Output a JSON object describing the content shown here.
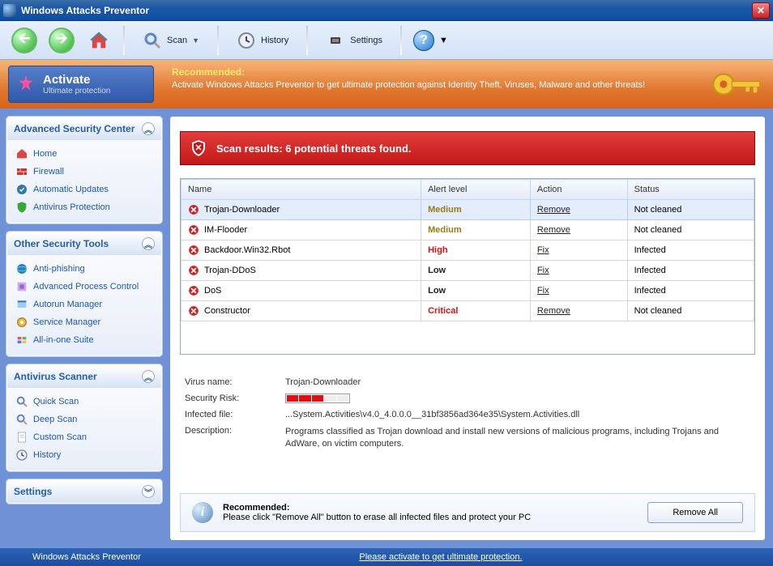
{
  "title": "Windows Attacks Preventor",
  "toolbar": {
    "scan": "Scan",
    "history": "History",
    "settings": "Settings"
  },
  "banner": {
    "activate": "Activate",
    "activate_sub": "Ultimate protection",
    "head": "Recommended:",
    "body": "Activate Windows Attacks Preventor to get ultimate protection against Identity Theft, Viruses, Malware and other threats!"
  },
  "panels": {
    "security": {
      "title": "Advanced Security Center",
      "items": [
        "Home",
        "Firewall",
        "Automatic Updates",
        "Antivirus Protection"
      ]
    },
    "tools": {
      "title": "Other Security Tools",
      "items": [
        "Anti-phishing",
        "Advanced Process Control",
        "Autorun Manager",
        "Service Manager",
        "All-in-one Suite"
      ]
    },
    "scanner": {
      "title": "Antivirus Scanner",
      "items": [
        "Quick Scan",
        "Deep Scan",
        "Custom Scan",
        "History"
      ]
    },
    "settings": {
      "title": "Settings"
    }
  },
  "results": {
    "header": "Scan results: 6 potential threats found.",
    "columns": [
      "Name",
      "Alert level",
      "Action",
      "Status"
    ],
    "rows": [
      {
        "name": "Trojan-Downloader",
        "level": "Medium",
        "levelClass": "alert-medium",
        "action": "Remove",
        "status": "Not cleaned",
        "sel": true
      },
      {
        "name": "IM-Flooder",
        "level": "Medium",
        "levelClass": "alert-medium",
        "action": "Remove",
        "status": "Not cleaned"
      },
      {
        "name": "Backdoor.Win32.Rbot",
        "level": "High",
        "levelClass": "alert-high",
        "action": "Fix",
        "status": "Infected"
      },
      {
        "name": "Trojan-DDoS",
        "level": "Low",
        "levelClass": "alert-low",
        "action": "Fix",
        "status": "Infected"
      },
      {
        "name": "DoS",
        "level": "Low",
        "levelClass": "alert-low",
        "action": "Fix",
        "status": "Infected"
      },
      {
        "name": "Constructor",
        "level": "Critical",
        "levelClass": "alert-critical",
        "action": "Remove",
        "status": "Not cleaned"
      }
    ]
  },
  "details": {
    "labels": {
      "name": "Virus name:",
      "risk": "Security Risk:",
      "file": "Infected file:",
      "desc": "Description:"
    },
    "name": "Trojan-Downloader",
    "risk_segments": 3,
    "risk_total": 5,
    "file": "...System.Activities\\v4.0_4.0.0.0__31bf3856ad364e35\\System.Activities.dll",
    "desc": "Programs classified as Trojan download and install new versions of malicious programs, including Trojans and AdWare, on victim computers."
  },
  "footer": {
    "head": "Recommended:",
    "body": "Please click \"Remove All\" button to erase all infected files and protect your PC",
    "button": "Remove All"
  },
  "statusbar": {
    "app": "Windows Attacks Preventor",
    "activate": "Please activate to get ultimate protection."
  }
}
